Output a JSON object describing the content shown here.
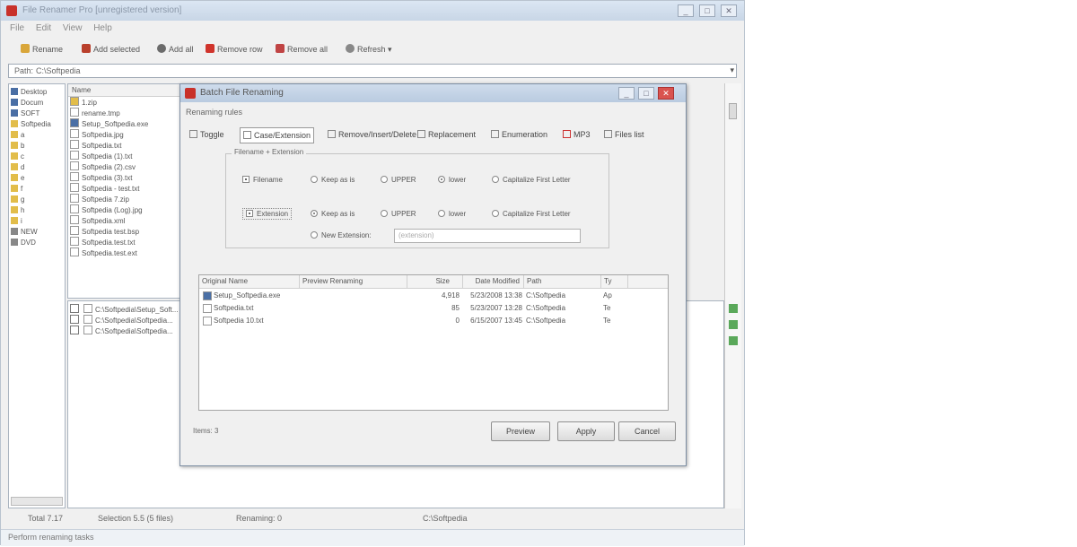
{
  "window": {
    "title": "File Renamer Pro [unregistered version]",
    "min_glyph": "_",
    "max_glyph": "□",
    "close_glyph": "✕"
  },
  "menu": [
    "File",
    "Edit",
    "View",
    "Help"
  ],
  "toolbar": {
    "rename": "Rename",
    "add_selected": "Add selected",
    "add_all": "Add all",
    "remove_row": "Remove row",
    "remove_all": "Remove all",
    "refresh": "Refresh"
  },
  "path": {
    "label": "Path:",
    "value": "C:\\Softpedia"
  },
  "tree": [
    "Desktop",
    "Docum",
    "SOFT",
    "Softpedia",
    "a",
    "b",
    "c",
    "d",
    "e",
    "f",
    "g",
    "h",
    "i",
    "NEW",
    "DVD"
  ],
  "files": {
    "header": "Name",
    "items": [
      "1.zip",
      "rename.tmp",
      "Setup_Softpedia.exe",
      "Softpedia.jpg",
      "Softpedia.txt",
      "Softpedia (1).txt",
      "Softpedia (2).csv",
      "Softpedia (3).txt",
      "Softpedia - test.txt",
      "Softpedia 7.zip",
      "Softpedia (Log).jpg",
      "Softpedia.xml",
      "Softpedia test.bsp",
      "Softpedia.test.txt",
      "Softpedia.test.ext"
    ]
  },
  "queue": [
    "C:\\Softpedia\\Setup_Soft...",
    "C:\\Softpedia\\Softpedia...",
    "C:\\Softpedia\\Softpedia..."
  ],
  "status": {
    "total": "Total 7.17",
    "selection": "Selection 5.5 (5 files)",
    "renaming": "Renaming: 0",
    "path": "C:\\Softpedia",
    "footer": "Perform renaming tasks"
  },
  "dialog": {
    "title": "Batch File Renaming",
    "section": "Renaming rules",
    "tabs": [
      "Toggle",
      "Case/Extension",
      "Remove/Insert/Delete",
      "Replacement",
      "Enumeration",
      "MP3",
      "Files list"
    ],
    "group_label": "Filename + Extension",
    "filename_check": "Filename",
    "extension_check": "Extension",
    "case_options": [
      "Keep as is",
      "UPPER",
      "lower",
      "Capitalize First Letter"
    ],
    "new_extension": "New Extension:",
    "new_extension_placeholder": "(extension)",
    "list": {
      "columns": [
        "Original Name",
        "Preview Renaming",
        "Size",
        "Date Modified",
        "Path",
        "Ty"
      ],
      "rows": [
        [
          "Setup_Softpedia.exe",
          "",
          "4,918",
          "5/23/2008 13:38",
          "C:\\Softpedia",
          "Ap"
        ],
        [
          "Softpedia.txt",
          "",
          "85",
          "5/23/2007 13:28",
          "C:\\Softpedia",
          "Te"
        ],
        [
          "Softpedia 10.txt",
          "",
          "0",
          "6/15/2007 13:45",
          "C:\\Softpedia",
          "Te"
        ]
      ]
    },
    "items": "Items: 3",
    "preview": "Preview",
    "apply": "Apply",
    "cancel": "Cancel"
  }
}
